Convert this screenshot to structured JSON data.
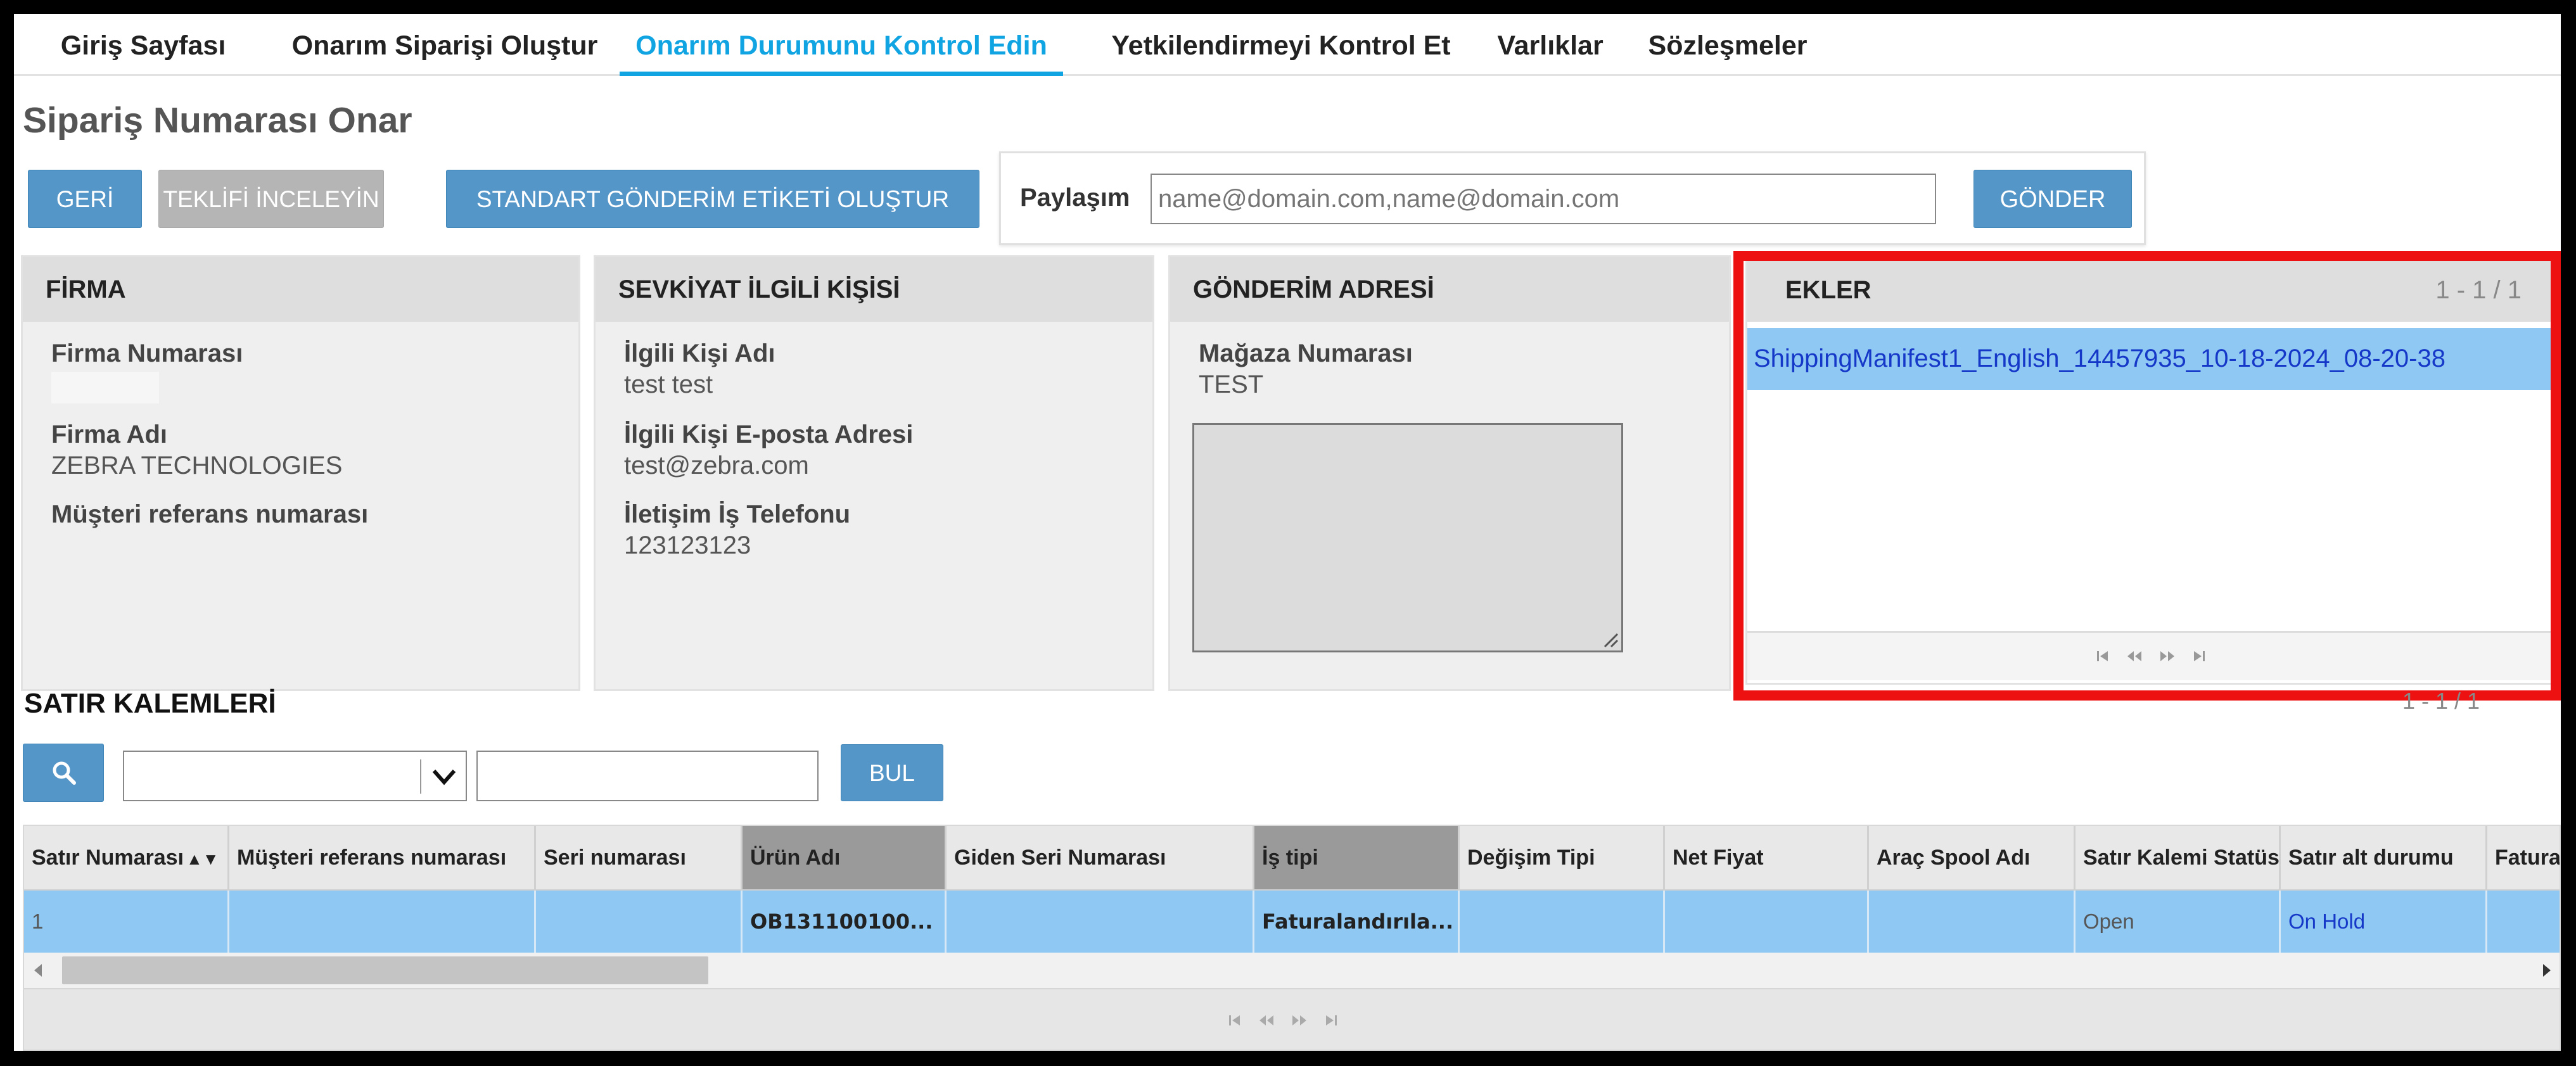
{
  "nav": {
    "tabs": [
      {
        "label": "Giriş Sayfası",
        "active": false
      },
      {
        "label": "Onarım Siparişi Oluştur",
        "active": false
      },
      {
        "label": "Onarım Durumunu Kontrol Edin",
        "active": true
      },
      {
        "label": "Yetkilendirmeyi Kontrol Et",
        "active": false
      },
      {
        "label": "Varlıklar",
        "active": false
      },
      {
        "label": "Sözleşmeler",
        "active": false
      }
    ]
  },
  "page": {
    "title": "Sipariş Numarası Onar"
  },
  "toolbar": {
    "back_label": "GERİ",
    "review_quote_label": "TEKLİFİ İNCELEYİN",
    "shipping_label_label": "STANDART GÖNDERİM ETİKETİ OLUŞTUR"
  },
  "share": {
    "label": "Paylaşım",
    "value": "",
    "placeholder": "name@domain.com,name@domain.com",
    "send_label": "GÖNDER"
  },
  "company": {
    "header": "FİRMA",
    "number_label": "Firma Numarası",
    "number_value": "",
    "name_label": "Firma Adı",
    "name_value": "ZEBRA TECHNOLOGIES",
    "customer_ref_label": "Müşteri referans numarası",
    "customer_ref_value": ""
  },
  "contact": {
    "header": "SEVKİYAT İLGİLİ KİŞİSİ",
    "name_label": "İlgili Kişi Adı",
    "name_value": "test test",
    "email_label": "İlgili Kişi E-posta Adresi",
    "email_value": "test@zebra.com",
    "phone_label": "İletişim İş Telefonu",
    "phone_value": "123123123"
  },
  "address": {
    "header": "GÖNDERİM ADRESİ",
    "store_label": "Mağaza Numarası",
    "store_value": "TEST",
    "address_text": ""
  },
  "attachments": {
    "header": "EKLER",
    "count": "1 - 1 / 1",
    "items": [
      "ShippingManifest1_English_14457935_10-18-2024_08-20-38"
    ]
  },
  "line_items": {
    "title": "SATIR KALEMLERİ",
    "count": "1 - 1 / 1",
    "filter_value": "",
    "search_value": "",
    "find_label": "BUL",
    "columns": [
      "Satır Numarası",
      "Müşteri referans numarası",
      "Seri numarası",
      "Ürün Adı",
      "Giden Seri Numarası",
      "İş tipi",
      "Değişim Tipi",
      "Net Fiyat",
      "Araç Spool Adı",
      "Satır Kalemi Statüsü",
      "Satır alt durumu",
      "Faturalama"
    ],
    "rows": [
      [
        "1",
        "",
        "",
        "OB131100100...",
        "",
        "Faturalandırıla...",
        "",
        "",
        "",
        "Open",
        "On Hold",
        ""
      ]
    ]
  },
  "colors": {
    "accent": "#11a4e2",
    "button": "#5596c8",
    "button_disabled": "#b5b5b5",
    "selected_row": "#8fc8f3",
    "link": "#1638c8",
    "highlight": "#ee1111"
  }
}
